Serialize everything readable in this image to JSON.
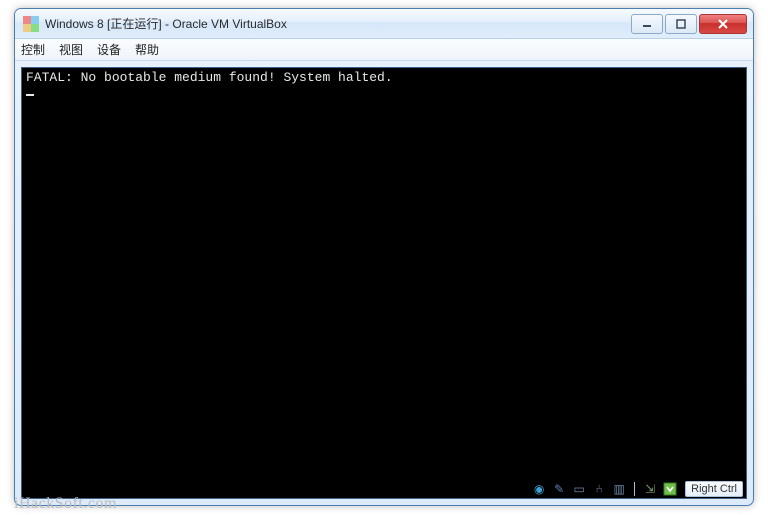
{
  "titlebar": {
    "title": "Windows 8 [正在运行] - Oracle VM VirtualBox"
  },
  "menu": {
    "control": "控制",
    "view": "视图",
    "devices": "设备",
    "help": "帮助"
  },
  "console": {
    "line1": "FATAL: No bootable medium found! System halted."
  },
  "status": {
    "host_key": "Right Ctrl"
  },
  "watermark": "iHackSoft.com"
}
